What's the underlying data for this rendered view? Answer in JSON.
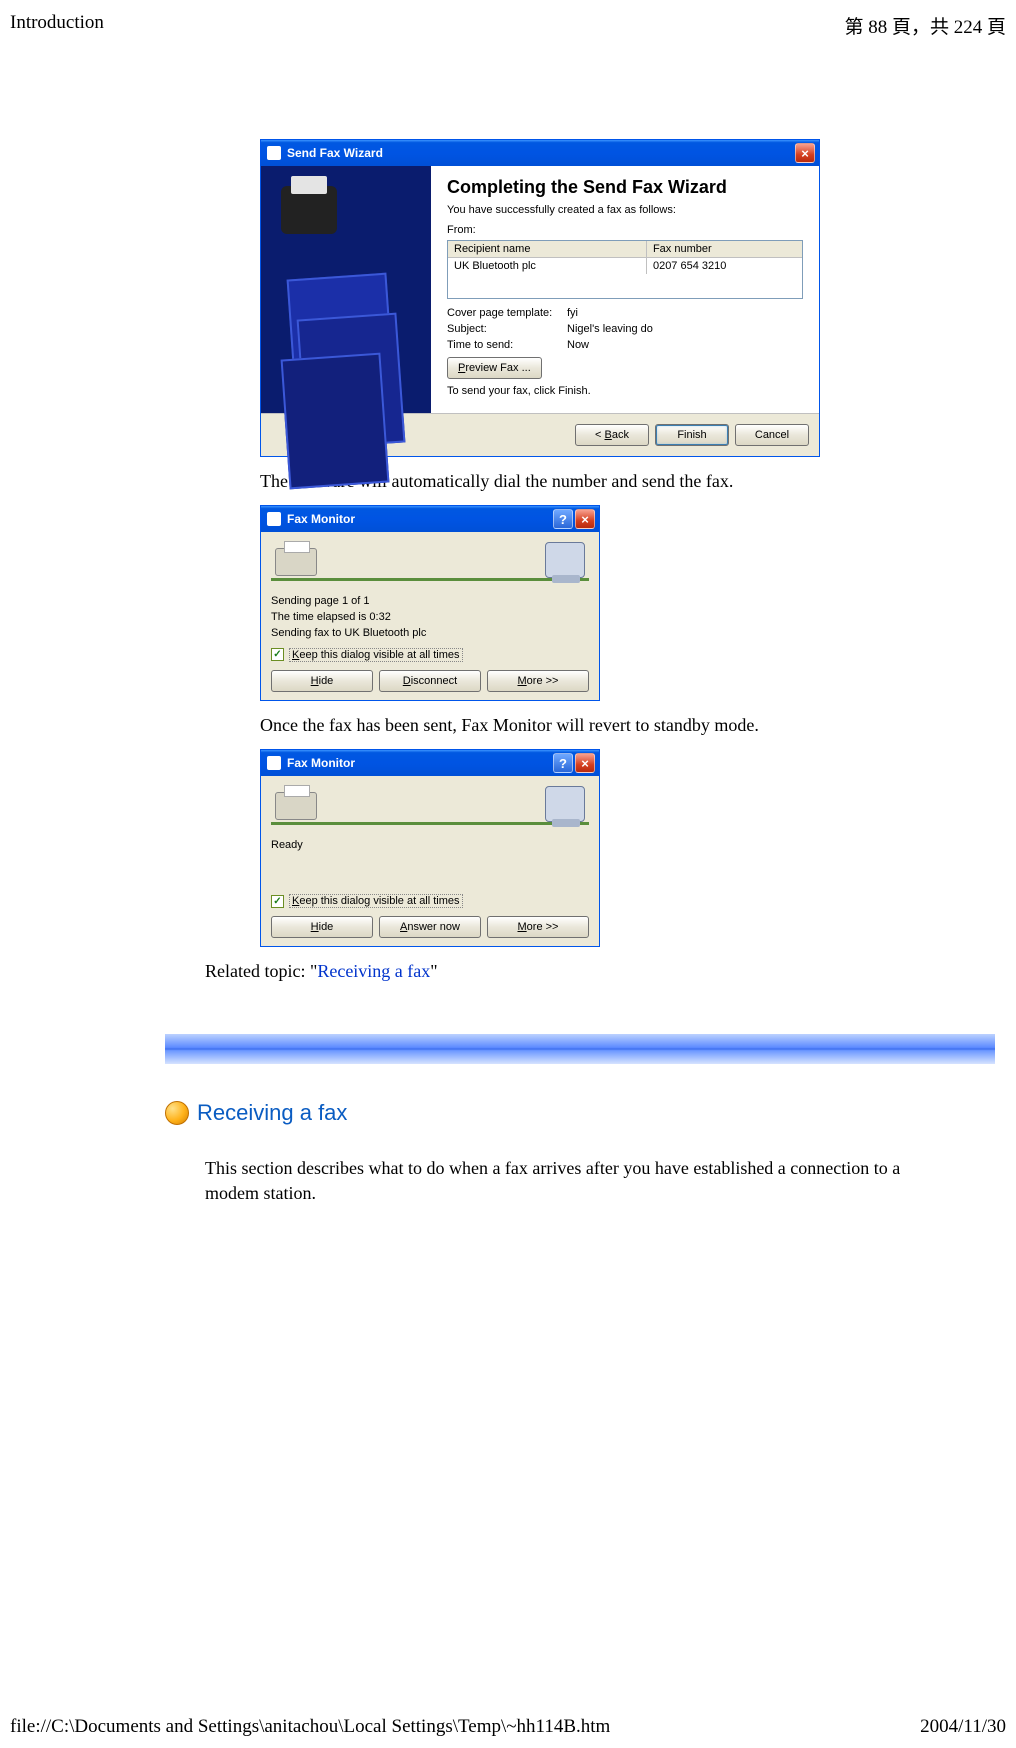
{
  "page_header": {
    "left": "Introduction",
    "right": "第 88 頁，共 224 頁"
  },
  "wizard": {
    "title": "Send Fax Wizard",
    "heading": "Completing the Send Fax Wizard",
    "subtext": "You have successfully created a fax as follows:",
    "from_label": "From:",
    "table": {
      "col1": "Recipient name",
      "col2": "Fax number",
      "row1_c1": "UK Bluetooth plc",
      "row1_c2": "0207 654 3210"
    },
    "kv": {
      "cover_label": "Cover page template:",
      "cover_value": "fyi",
      "subject_label": "Subject:",
      "subject_value": "Nigel's leaving do",
      "time_label": "Time to send:",
      "time_value": "Now"
    },
    "preview_btn": "Preview Fax ...",
    "finish_note": "To send your fax, click Finish.",
    "back_btn": "< Back",
    "finish_btn": "Finish",
    "cancel_btn": "Cancel"
  },
  "para1": "The software will automatically dial the number and send the fax.",
  "monitor1": {
    "title": "Fax Monitor",
    "line1": "Sending page 1 of 1",
    "line2": "The time elapsed is 0:32",
    "line3": "Sending fax to UK Bluetooth plc",
    "check_label": "Keep this dialog visible at all times",
    "check_u": "K",
    "btn_hide": "Hide",
    "btn_hide_u": "H",
    "btn_disconnect": "Disconnect",
    "btn_disconnect_u": "D",
    "btn_more": "More >>",
    "btn_more_u": "M"
  },
  "para2": "Once the fax has been sent, Fax Monitor will revert to standby mode.",
  "monitor2": {
    "title": "Fax Monitor",
    "status": "Ready",
    "check_label": "Keep this dialog visible at all times",
    "check_u": "K",
    "btn_hide": "Hide",
    "btn_hide_u": "H",
    "btn_answer": "Answer now",
    "btn_answer_u": "A",
    "btn_more": "More >>",
    "btn_more_u": "M"
  },
  "related": {
    "prefix": "Related topic: \"",
    "link": "Receiving a fax",
    "suffix": "\""
  },
  "section_heading": "Receiving a fax",
  "section_para": "This section describes what to do when a fax arrives after you have established a connection to a modem station.",
  "page_footer": {
    "left": "file://C:\\Documents and Settings\\anitachou\\Local Settings\\Temp\\~hh114B.htm",
    "right": "2004/11/30"
  }
}
